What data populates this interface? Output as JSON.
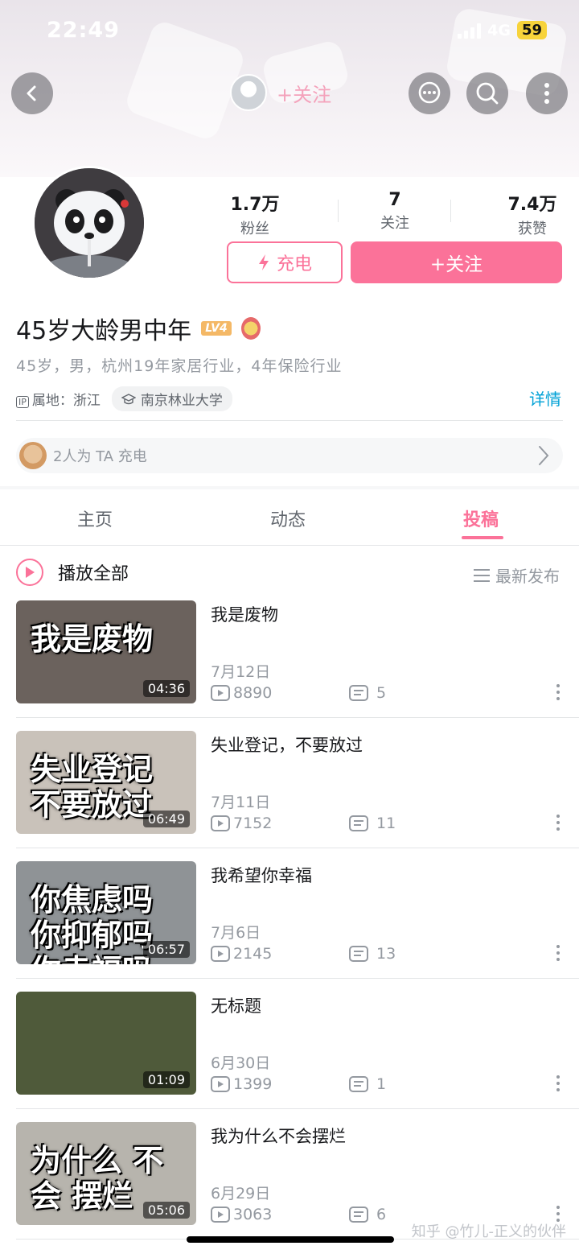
{
  "status_bar": {
    "time": "22:49",
    "network": "4G",
    "battery": "59"
  },
  "header": {
    "follow_label": "+关注"
  },
  "profile": {
    "stats": [
      {
        "value": "1.7万",
        "label": "粉丝"
      },
      {
        "value": "7",
        "label": "关注"
      },
      {
        "value": "7.4万",
        "label": "获赞"
      }
    ],
    "charge_button": "充电",
    "follow_button": "+关注",
    "username": "45岁大龄男中年",
    "level": "LV4",
    "bio": "45岁，男，杭州19年家居行业，4年保险行业",
    "ip_tag": "IP",
    "ip_location": "属地：浙江",
    "school": "南京林业大学",
    "detail_link": "详情",
    "charge_summary": "2人为 TA 充电"
  },
  "tabs": [
    {
      "label": "主页",
      "active": false
    },
    {
      "label": "动态",
      "active": false
    },
    {
      "label": "投稿",
      "active": true
    }
  ],
  "list_header": {
    "play_all": "播放全部",
    "sort": "最新发布"
  },
  "videos": [
    {
      "title": "我是废物",
      "date": "7月12日",
      "plays": "8890",
      "comments": "5",
      "duration": "04:36",
      "thumb_text": "我是废物",
      "thumb_color": "#6b625d"
    },
    {
      "title": "失业登记，不要放过",
      "date": "7月11日",
      "plays": "7152",
      "comments": "11",
      "duration": "06:49",
      "thumb_text": "失业登记 不要放过",
      "thumb_color": "#c9c2ba"
    },
    {
      "title": "我希望你幸福",
      "date": "7月6日",
      "plays": "2145",
      "comments": "13",
      "duration": "06:57",
      "thumb_text": "你焦虑吗 你抑郁吗 你幸福吗",
      "thumb_color": "#8f9396"
    },
    {
      "title": "无标题",
      "date": "6月30日",
      "plays": "1399",
      "comments": "1",
      "duration": "01:09",
      "thumb_text": "",
      "thumb_color": "#4f5a3a"
    },
    {
      "title": "我为什么不会摆烂",
      "date": "6月29日",
      "plays": "3063",
      "comments": "6",
      "duration": "05:06",
      "thumb_text": "为什么 不会 摆烂",
      "thumb_color": "#b7b4ad"
    }
  ],
  "watermark": "知乎 @竹儿-正义的伙伴",
  "colors": {
    "accent": "#fb7299",
    "link": "#00a1d6",
    "muted": "#9499a0"
  }
}
